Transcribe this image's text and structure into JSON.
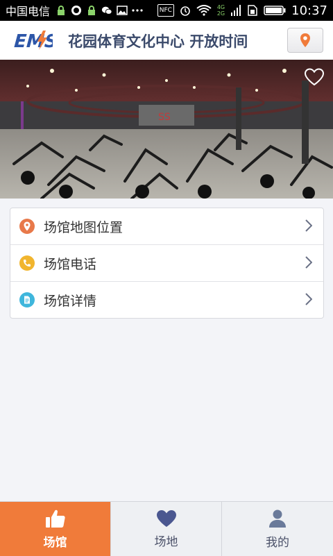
{
  "status_bar": {
    "carrier": "中国电信",
    "time": "10:37",
    "nfc_label": "NFC",
    "net_top": "4G",
    "net_bottom": "2G"
  },
  "header": {
    "logo_text": "EMS",
    "title": "花园体育文化中心 开放时间"
  },
  "venue_links": [
    {
      "label": "场馆地图位置",
      "icon": "location-pin-icon",
      "color": "#e8794a"
    },
    {
      "label": "场馆电话",
      "icon": "phone-icon",
      "color": "#f1b52e"
    },
    {
      "label": "场馆详情",
      "icon": "document-icon",
      "color": "#3fb6dc"
    }
  ],
  "tabs": [
    {
      "label": "场馆",
      "icon": "thumbs-up-icon",
      "active": true
    },
    {
      "label": "场地",
      "icon": "heart-icon",
      "active": false
    },
    {
      "label": "我的",
      "icon": "person-icon",
      "active": false
    }
  ],
  "colors": {
    "accent": "#f07b3a",
    "title": "#3b4a6b"
  }
}
